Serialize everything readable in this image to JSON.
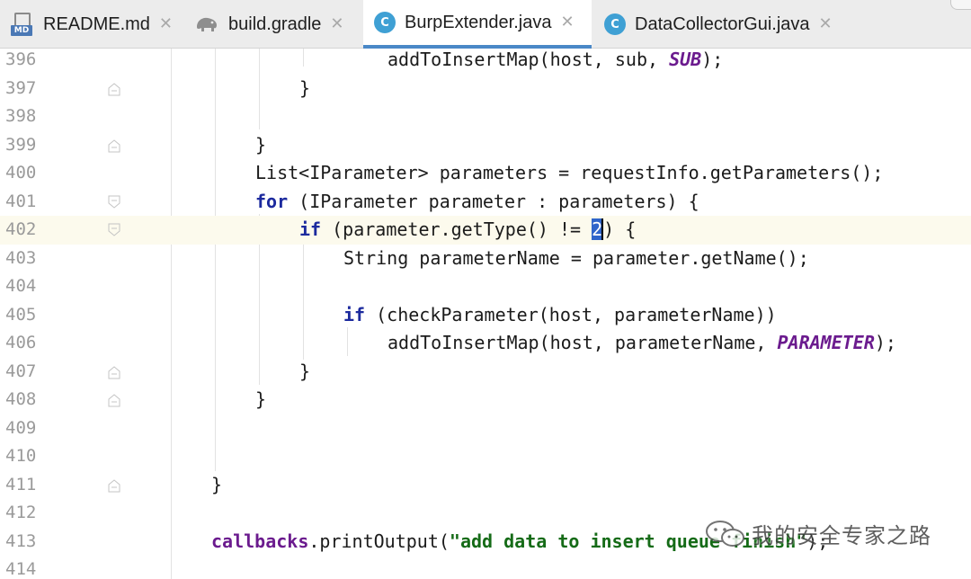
{
  "tabs": [
    {
      "label": "README.md",
      "icon": "markdown-file-icon",
      "active": false
    },
    {
      "label": "build.gradle",
      "icon": "gradle-elephant-icon",
      "active": false
    },
    {
      "label": "BurpExtender.java",
      "icon": "java-class-icon",
      "active": true
    },
    {
      "label": "DataCollectorGui.java",
      "icon": "java-class-icon",
      "active": false
    }
  ],
  "markdown_badge": "MD",
  "class_badge": "C",
  "close_glyph": "✕",
  "colors": {
    "keyword": "#1c2a9e",
    "constant": "#6b1b8e",
    "string": "#156b17",
    "selection": "#2f65ca",
    "current_line": "#fcfaed",
    "active_tab_underline": "#4a88c7"
  },
  "current_line": "402",
  "lines": [
    {
      "num": "396",
      "code": "addToInsertMap(host, sub, SUB);"
    },
    {
      "num": "397",
      "code": "}"
    },
    {
      "num": "398",
      "code": ""
    },
    {
      "num": "399",
      "code": "}"
    },
    {
      "num": "400",
      "code": "List<IParameter> parameters = requestInfo.getParameters();"
    },
    {
      "num": "401",
      "code": "for (IParameter parameter : parameters) {"
    },
    {
      "num": "402",
      "code": "if (parameter.getType() != 2) {"
    },
    {
      "num": "403",
      "code": "String parameterName = parameter.getName();"
    },
    {
      "num": "404",
      "code": ""
    },
    {
      "num": "405",
      "code": "if (checkParameter(host, parameterName))"
    },
    {
      "num": "406",
      "code": "addToInsertMap(host, parameterName, PARAMETER);"
    },
    {
      "num": "407",
      "code": "}"
    },
    {
      "num": "408",
      "code": "}"
    },
    {
      "num": "409",
      "code": ""
    },
    {
      "num": "410",
      "code": ""
    },
    {
      "num": "411",
      "code": "}"
    },
    {
      "num": "412",
      "code": ""
    },
    {
      "num": "413",
      "code": "callbacks.printOutput(\"add data to insert queue finish\");"
    },
    {
      "num": "414",
      "code": ""
    }
  ],
  "watermark": "我的安全专家之路"
}
